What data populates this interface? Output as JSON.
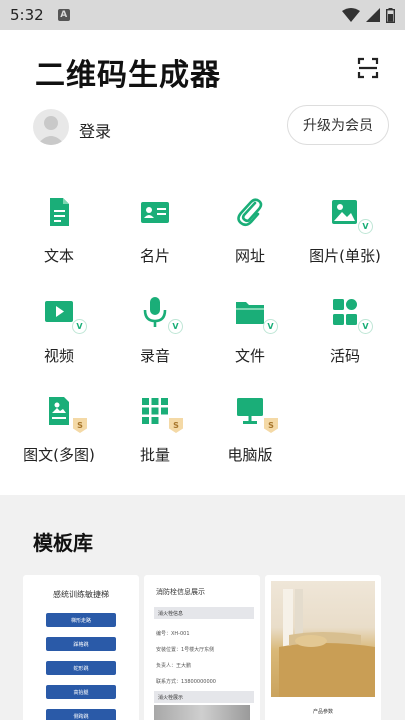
{
  "status_bar": {
    "time": "5:32",
    "notification_icon": "a-icon",
    "wifi_icon": "wifi-icon",
    "signal_icon": "signal-icon",
    "battery_icon": "battery-icon"
  },
  "header": {
    "title": "二维码生成器",
    "scan_icon": "scan-icon"
  },
  "user": {
    "login_label": "登录",
    "vip_label": "升级为会员"
  },
  "accent_color": "#1aae78",
  "grid": [
    {
      "label": "文本",
      "icon": "document-icon",
      "badge": ""
    },
    {
      "label": "名片",
      "icon": "business-card-icon",
      "badge": ""
    },
    {
      "label": "网址",
      "icon": "link-icon",
      "badge": ""
    },
    {
      "label": "图片(单张)",
      "icon": "image-icon",
      "badge": "V"
    },
    {
      "label": "视频",
      "icon": "video-icon",
      "badge": "V"
    },
    {
      "label": "录音",
      "icon": "microphone-icon",
      "badge": "V"
    },
    {
      "label": "文件",
      "icon": "folder-icon",
      "badge": "V"
    },
    {
      "label": "活码",
      "icon": "dynamic-code-icon",
      "badge": "V"
    },
    {
      "label": "图文(多图)",
      "icon": "image-text-icon",
      "badge": "S"
    },
    {
      "label": "批量",
      "icon": "batch-icon",
      "badge": "S"
    },
    {
      "label": "电脑版",
      "icon": "desktop-icon",
      "badge": "S"
    }
  ],
  "templates": {
    "title": "模板库",
    "card1": {
      "title": "感统训练敏捷梯",
      "buttons": [
        "梯形走路",
        "踩格跳",
        "蛇形跳",
        "高抬腿",
        "侧跨跳"
      ]
    },
    "card2": {
      "title": "消防栓信息展示",
      "section1": "消火栓信息",
      "lines": [
        "编号：XH-001",
        "安装位置：1号楼大厅东侧",
        "负责人：王大鹏",
        "联系方式：13800000000"
      ],
      "section2": "消火栓展示"
    },
    "card3": {
      "label": "产品参数"
    }
  }
}
